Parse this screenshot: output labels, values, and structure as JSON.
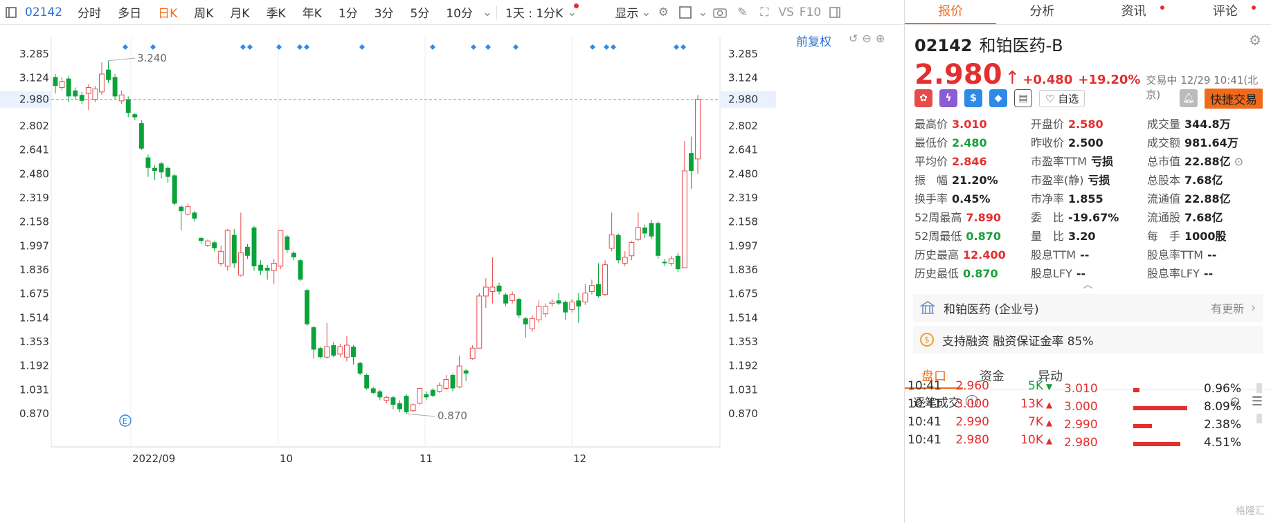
{
  "toolbar": {
    "code": "02142",
    "periods": [
      "分时",
      "多日",
      "日K",
      "周K",
      "月K",
      "季K",
      "年K",
      "1分",
      "3分",
      "5分",
      "10分"
    ],
    "active_period": "日K",
    "range_label": "1天 : 1分K",
    "display_label": "显示",
    "vs_label": "VS",
    "f10_label": "F10"
  },
  "chart": {
    "restore_label": "前复权",
    "current_price_label": "2.980",
    "high_mark_label": "3.240",
    "low_mark_label": "0.870",
    "event_marker": "E",
    "x_labels": [
      "2022/09",
      "10",
      "11",
      "12"
    ]
  },
  "chart_data": {
    "type": "candlestick",
    "ylim": [
      0.78,
      3.34
    ],
    "y_ticks": [
      "3.285",
      "3.124",
      "2.980",
      "2.802",
      "2.641",
      "2.480",
      "2.319",
      "2.158",
      "1.997",
      "1.836",
      "1.675",
      "1.514",
      "1.353",
      "1.192",
      "1.031",
      "0.870"
    ],
    "x_tick_labels": [
      "2022/09",
      "10",
      "11",
      "12"
    ],
    "current_price": 2.98,
    "high_annotation": 3.24,
    "low_annotation": 0.87,
    "candles": [
      {
        "o": 3.13,
        "c": 3.07,
        "h": 3.15,
        "l": 3.02
      },
      {
        "o": 3.06,
        "c": 3.1,
        "h": 3.13,
        "l": 3.04
      },
      {
        "o": 3.12,
        "c": 3.0,
        "h": 3.14,
        "l": 2.96
      },
      {
        "o": 3.04,
        "c": 3.0,
        "h": 3.06,
        "l": 2.98
      },
      {
        "o": 3.01,
        "c": 2.97,
        "h": 3.03,
        "l": 2.95
      },
      {
        "o": 3.02,
        "c": 3.06,
        "h": 3.08,
        "l": 2.91
      },
      {
        "o": 2.98,
        "c": 3.05,
        "h": 3.07,
        "l": 2.96
      },
      {
        "o": 3.03,
        "c": 3.15,
        "h": 3.23,
        "l": 3.01
      },
      {
        "o": 3.18,
        "c": 3.11,
        "h": 3.24,
        "l": 3.09
      },
      {
        "o": 3.13,
        "c": 3.0,
        "h": 3.15,
        "l": 2.98
      },
      {
        "o": 2.97,
        "c": 3.01,
        "h": 3.04,
        "l": 2.95
      },
      {
        "o": 2.98,
        "c": 2.89,
        "h": 3.0,
        "l": 2.86
      },
      {
        "o": 2.88,
        "c": 2.86,
        "h": 2.89,
        "l": 2.84
      },
      {
        "o": 2.82,
        "c": 2.65,
        "h": 2.84,
        "l": 2.64
      },
      {
        "o": 2.59,
        "c": 2.52,
        "h": 2.61,
        "l": 2.46
      },
      {
        "o": 2.52,
        "c": 2.5,
        "h": 2.54,
        "l": 2.44
      },
      {
        "o": 2.55,
        "c": 2.49,
        "h": 2.56,
        "l": 2.45
      },
      {
        "o": 2.52,
        "c": 2.46,
        "h": 2.53,
        "l": 2.42
      },
      {
        "o": 2.47,
        "c": 2.28,
        "h": 2.48,
        "l": 2.27
      },
      {
        "o": 2.26,
        "c": 2.23,
        "h": 2.27,
        "l": 2.1
      },
      {
        "o": 2.21,
        "c": 2.26,
        "h": 2.28,
        "l": 2.2
      },
      {
        "o": 2.22,
        "c": 2.18,
        "h": 2.23,
        "l": 2.16
      },
      {
        "o": 2.05,
        "c": 2.03,
        "h": 2.06,
        "l": 2.01
      },
      {
        "o": 2.0,
        "c": 2.03,
        "h": 2.04,
        "l": 1.99
      },
      {
        "o": 2.02,
        "c": 1.98,
        "h": 2.03,
        "l": 1.96
      },
      {
        "o": 1.88,
        "c": 1.96,
        "h": 2.0,
        "l": 1.86
      },
      {
        "o": 1.86,
        "c": 2.1,
        "h": 2.11,
        "l": 1.83
      },
      {
        "o": 2.07,
        "c": 1.88,
        "h": 2.11,
        "l": 1.85
      },
      {
        "o": 1.8,
        "c": 1.95,
        "h": 2.22,
        "l": 1.79
      },
      {
        "o": 1.99,
        "c": 1.93,
        "h": 2.01,
        "l": 1.91
      },
      {
        "o": 2.12,
        "c": 1.86,
        "h": 2.13,
        "l": 1.83
      },
      {
        "o": 1.87,
        "c": 1.83,
        "h": 1.9,
        "l": 1.8
      },
      {
        "o": 1.85,
        "c": 1.83,
        "h": 1.87,
        "l": 1.77
      },
      {
        "o": 1.83,
        "c": 1.88,
        "h": 1.91,
        "l": 1.74
      },
      {
        "o": 1.86,
        "c": 2.1,
        "h": 2.1,
        "l": 1.84
      },
      {
        "o": 2.06,
        "c": 1.97,
        "h": 2.07,
        "l": 1.95
      },
      {
        "o": 1.95,
        "c": 1.92,
        "h": 1.96,
        "l": 1.9
      },
      {
        "o": 1.9,
        "c": 1.77,
        "h": 1.91,
        "l": 1.76
      },
      {
        "o": 1.7,
        "c": 1.47,
        "h": 1.71,
        "l": 1.46
      },
      {
        "o": 1.45,
        "c": 1.3,
        "h": 1.46,
        "l": 1.24
      },
      {
        "o": 1.31,
        "c": 1.25,
        "h": 1.32,
        "l": 1.24
      },
      {
        "o": 1.25,
        "c": 1.32,
        "h": 1.48,
        "l": 1.24
      },
      {
        "o": 1.33,
        "c": 1.26,
        "h": 1.35,
        "l": 1.25
      },
      {
        "o": 1.27,
        "c": 1.32,
        "h": 1.34,
        "l": 1.25
      },
      {
        "o": 1.25,
        "c": 1.33,
        "h": 1.39,
        "l": 1.22
      },
      {
        "o": 1.32,
        "c": 1.25,
        "h": 1.33,
        "l": 1.2
      },
      {
        "o": 1.21,
        "c": 1.14,
        "h": 1.22,
        "l": 1.13
      },
      {
        "o": 1.13,
        "c": 1.04,
        "h": 1.14,
        "l": 1.03
      },
      {
        "o": 1.04,
        "c": 1.01,
        "h": 1.05,
        "l": 1.0
      },
      {
        "o": 1.02,
        "c": 0.98,
        "h": 1.03,
        "l": 0.96
      },
      {
        "o": 0.96,
        "c": 0.98,
        "h": 0.99,
        "l": 0.94
      },
      {
        "o": 0.98,
        "c": 0.93,
        "h": 0.99,
        "l": 0.9
      },
      {
        "o": 0.94,
        "c": 0.9,
        "h": 0.96,
        "l": 0.88
      },
      {
        "o": 0.99,
        "c": 0.88,
        "h": 1.0,
        "l": 0.87
      },
      {
        "o": 0.89,
        "c": 0.93,
        "h": 0.94,
        "l": 0.88
      },
      {
        "o": 0.94,
        "c": 1.04,
        "h": 1.04,
        "l": 0.93
      },
      {
        "o": 1.0,
        "c": 0.98,
        "h": 1.02,
        "l": 0.96
      },
      {
        "o": 1.03,
        "c": 0.99,
        "h": 1.04,
        "l": 0.98
      },
      {
        "o": 1.02,
        "c": 1.06,
        "h": 1.08,
        "l": 1.01
      },
      {
        "o": 1.04,
        "c": 1.1,
        "h": 1.13,
        "l": 1.03
      },
      {
        "o": 1.13,
        "c": 1.04,
        "h": 1.14,
        "l": 1.02
      },
      {
        "o": 1.05,
        "c": 1.19,
        "h": 1.26,
        "l": 1.04
      },
      {
        "o": 1.16,
        "c": 1.14,
        "h": 1.17,
        "l": 1.09
      },
      {
        "o": 1.24,
        "c": 1.31,
        "h": 1.33,
        "l": 1.23
      },
      {
        "o": 1.31,
        "c": 1.66,
        "h": 1.68,
        "l": 1.31
      },
      {
        "o": 1.66,
        "c": 1.72,
        "h": 1.78,
        "l": 1.58
      },
      {
        "o": 1.69,
        "c": 1.72,
        "h": 1.92,
        "l": 1.61
      },
      {
        "o": 1.73,
        "c": 1.69,
        "h": 1.75,
        "l": 1.67
      },
      {
        "o": 1.67,
        "c": 1.61,
        "h": 1.68,
        "l": 1.59
      },
      {
        "o": 1.63,
        "c": 1.67,
        "h": 1.69,
        "l": 1.61
      },
      {
        "o": 1.64,
        "c": 1.53,
        "h": 1.65,
        "l": 1.51
      },
      {
        "o": 1.51,
        "c": 1.47,
        "h": 1.52,
        "l": 1.38
      },
      {
        "o": 1.44,
        "c": 1.51,
        "h": 1.53,
        "l": 1.42
      },
      {
        "o": 1.5,
        "c": 1.59,
        "h": 1.63,
        "l": 1.48
      },
      {
        "o": 1.54,
        "c": 1.59,
        "h": 1.61,
        "l": 1.52
      },
      {
        "o": 1.61,
        "c": 1.62,
        "h": 1.64,
        "l": 1.59
      },
      {
        "o": 1.63,
        "c": 1.61,
        "h": 1.68,
        "l": 1.6
      },
      {
        "o": 1.62,
        "c": 1.55,
        "h": 1.63,
        "l": 1.5
      },
      {
        "o": 1.57,
        "c": 1.62,
        "h": 1.64,
        "l": 1.55
      },
      {
        "o": 1.63,
        "c": 1.59,
        "h": 1.68,
        "l": 1.48
      },
      {
        "o": 1.62,
        "c": 1.68,
        "h": 1.74,
        "l": 1.6
      },
      {
        "o": 1.69,
        "c": 1.73,
        "h": 1.77,
        "l": 1.67
      },
      {
        "o": 1.74,
        "c": 1.66,
        "h": 1.88,
        "l": 1.65
      },
      {
        "o": 1.67,
        "c": 1.87,
        "h": 1.9,
        "l": 1.66
      },
      {
        "o": 1.98,
        "c": 2.07,
        "h": 2.22,
        "l": 1.96
      },
      {
        "o": 2.07,
        "c": 1.9,
        "h": 2.08,
        "l": 1.88
      },
      {
        "o": 1.88,
        "c": 1.92,
        "h": 1.96,
        "l": 1.86
      },
      {
        "o": 1.93,
        "c": 2.02,
        "h": 2.03,
        "l": 1.9
      },
      {
        "o": 2.04,
        "c": 2.12,
        "h": 2.22,
        "l": 2.03
      },
      {
        "o": 2.12,
        "c": 2.08,
        "h": 2.14,
        "l": 2.05
      },
      {
        "o": 2.15,
        "c": 2.06,
        "h": 2.17,
        "l": 2.04
      },
      {
        "o": 2.15,
        "c": 1.93,
        "h": 2.16,
        "l": 1.91
      },
      {
        "o": 1.89,
        "c": 1.88,
        "h": 1.91,
        "l": 1.86
      },
      {
        "o": 1.88,
        "c": 1.91,
        "h": 1.93,
        "l": 1.86
      },
      {
        "o": 1.93,
        "c": 1.84,
        "h": 1.95,
        "l": 1.82
      },
      {
        "o": 1.85,
        "c": 2.5,
        "h": 2.7,
        "l": 1.85
      },
      {
        "o": 2.62,
        "c": 2.5,
        "h": 2.73,
        "l": 2.38
      },
      {
        "o": 2.58,
        "c": 2.98,
        "h": 3.01,
        "l": 2.48
      }
    ]
  },
  "panel": {
    "tabs": [
      "报价",
      "分析",
      "资讯",
      "评论"
    ],
    "code": "02142",
    "name": "和铂医药-B",
    "price": "2.980",
    "change": "+0.480",
    "change_pct": "+19.20%",
    "trade_status": "交易中 12/29 10:41(北京)",
    "watch_label": "自选",
    "quick_trade_label": "快捷交易",
    "stats": [
      [
        {
          "k": "最高价",
          "v": "3.010",
          "c": "red"
        },
        {
          "k": "开盘价",
          "v": "2.580",
          "c": "red"
        },
        {
          "k": "成交量",
          "v": "344.8万",
          "c": "dark"
        }
      ],
      [
        {
          "k": "最低价",
          "v": "2.480",
          "c": "green"
        },
        {
          "k": "昨收价",
          "v": "2.500",
          "c": "dark"
        },
        {
          "k": "成交额",
          "v": "981.64万",
          "c": "dark"
        }
      ],
      [
        {
          "k": "平均价",
          "v": "2.846",
          "c": "red"
        },
        {
          "k": "市盈率TTM",
          "v": "亏损",
          "c": "dark"
        },
        {
          "k": "总市值",
          "v": "22.88亿",
          "c": "dark"
        }
      ],
      [
        {
          "k": "振　幅",
          "v": "21.20%",
          "c": "dark"
        },
        {
          "k": "市盈率(静)",
          "v": "亏损",
          "c": "dark"
        },
        {
          "k": "总股本",
          "v": "7.68亿",
          "c": "dark"
        }
      ],
      [
        {
          "k": "换手率",
          "v": "0.45%",
          "c": "dark"
        },
        {
          "k": "市净率",
          "v": "1.855",
          "c": "dark"
        },
        {
          "k": "流通值",
          "v": "22.88亿",
          "c": "dark"
        }
      ],
      [
        {
          "k": "52周最高",
          "v": "7.890",
          "c": "red"
        },
        {
          "k": "委　比",
          "v": "-19.67%",
          "c": "dark"
        },
        {
          "k": "流通股",
          "v": "7.68亿",
          "c": "dark"
        }
      ],
      [
        {
          "k": "52周最低",
          "v": "0.870",
          "c": "green"
        },
        {
          "k": "量　比",
          "v": "3.20",
          "c": "dark"
        },
        {
          "k": "每　手",
          "v": "1000股",
          "c": "dark"
        }
      ],
      [
        {
          "k": "历史最高",
          "v": "12.400",
          "c": "red"
        },
        {
          "k": "股息TTM",
          "v": "--",
          "c": "dark"
        },
        {
          "k": "股息率TTM",
          "v": "--",
          "c": "dark"
        }
      ],
      [
        {
          "k": "历史最低",
          "v": "0.870",
          "c": "green"
        },
        {
          "k": "股息LFY",
          "v": "--",
          "c": "dark"
        },
        {
          "k": "股息率LFY",
          "v": "--",
          "c": "dark"
        }
      ]
    ],
    "company_label": "和铂医药 (企业号)",
    "company_update": "有更新",
    "margin_label": "支持融资 融资保证金率 85%",
    "sub_tabs": [
      "盘口",
      "资金",
      "异动"
    ],
    "tick_title": "逐笔成交",
    "ticks": [
      {
        "time": "10:41",
        "price": "2.960",
        "vol": "5K",
        "dir": "down"
      },
      {
        "time": "10:41",
        "price": "3.000",
        "vol": "13K",
        "dir": "up"
      },
      {
        "time": "10:41",
        "price": "2.990",
        "vol": "7K",
        "dir": "up"
      },
      {
        "time": "10:41",
        "price": "2.980",
        "vol": "10K",
        "dir": "up"
      }
    ],
    "distribution": [
      {
        "price": "3.010",
        "pct": "0.96%",
        "ratio": 0.06
      },
      {
        "price": "3.000",
        "pct": "8.09%",
        "ratio": 0.52
      },
      {
        "price": "2.990",
        "pct": "2.38%",
        "ratio": 0.18
      },
      {
        "price": "2.980",
        "pct": "4.51%",
        "ratio": 0.45
      }
    ],
    "watermark": "格隆汇"
  },
  "colors": {
    "up": "#e84a4a",
    "down": "#0aa33a",
    "accent": "#f06a1a",
    "blue": "#2b6fd6"
  }
}
